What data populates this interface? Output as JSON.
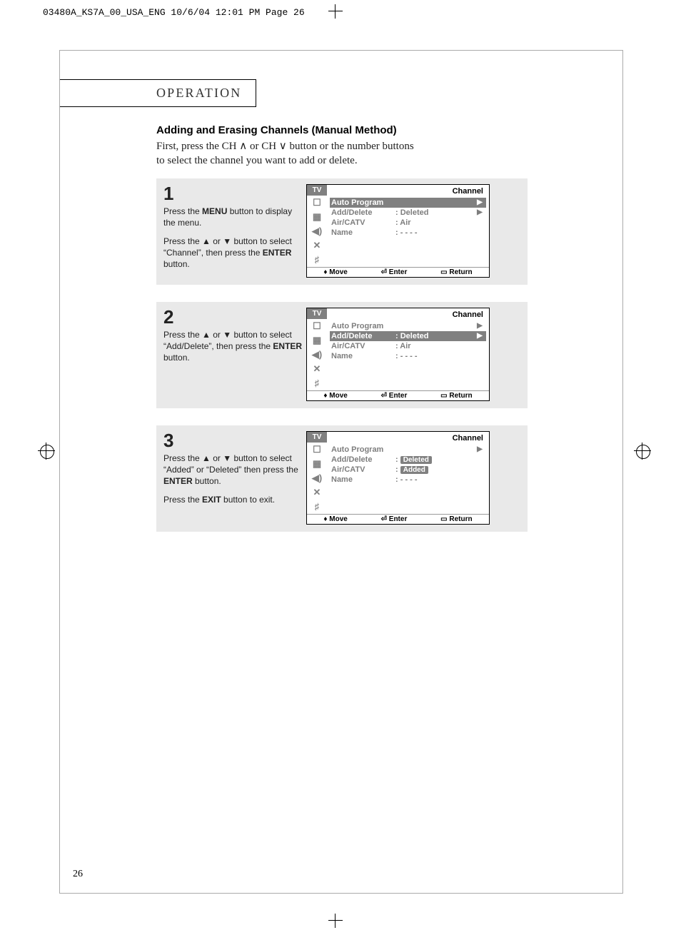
{
  "slug": "03480A_KS7A_00_USA_ENG  10/6/04  12:01 PM  Page 26",
  "section_title": "OPERATION",
  "heading": "Adding and Erasing Channels (Manual Method)",
  "intro_line1": "First, press the CH ∧ or CH ∨ button or the number buttons",
  "intro_line2": "to select the channel you want to add or delete.",
  "page_number": "26",
  "steps": [
    {
      "num": "1",
      "text_parts": [
        "Press the <b>MENU</b> button to display the menu.",
        "Press the ▲ or ▼ button to select “Channel”, then press the <b>ENTER</b> button."
      ],
      "osd_title": "Channel",
      "osd_rows": [
        {
          "label": "Auto Program",
          "val": "",
          "arrow": "▶",
          "sel": true
        },
        {
          "label": "Add/Delete",
          "val": ":  Deleted",
          "arrow": "▶",
          "sel": false
        },
        {
          "label": "Air/CATV",
          "val": ":  Air",
          "arrow": "",
          "sel": false
        },
        {
          "label": "Name",
          "val": ":  - - - -",
          "arrow": "",
          "sel": false
        }
      ]
    },
    {
      "num": "2",
      "text_parts": [
        "Press the ▲ or ▼ button to select “Add/Delete”, then press the <b>ENTER</b> button."
      ],
      "osd_title": "Channel",
      "osd_rows": [
        {
          "label": "Auto Program",
          "val": "",
          "arrow": "▶",
          "sel": false
        },
        {
          "label": "Add/Delete",
          "val": ":  Deleted",
          "arrow": "▶",
          "sel": true
        },
        {
          "label": "Air/CATV",
          "val": ":  Air",
          "arrow": "",
          "sel": false
        },
        {
          "label": "Name",
          "val": ":  - - - -",
          "arrow": "",
          "sel": false
        }
      ]
    },
    {
      "num": "3",
      "text_parts": [
        "Press the ▲ or ▼ button to select “Added” or “Deleted” then press the <b>ENTER</b> button.",
        "Press the <b>EXIT</b> button to exit."
      ],
      "osd_title": "Channel",
      "osd_rows": [
        {
          "label": "Auto Program",
          "val": "",
          "arrow": "▶",
          "sel": false
        },
        {
          "label": "Add/Delete",
          "val": ": ",
          "pill": "Deleted",
          "arrow": "",
          "sel": false
        },
        {
          "label": "Air/CATV",
          "val": ": ",
          "pill": "Added",
          "arrow": "",
          "sel": false
        },
        {
          "label": "Name",
          "val": ":  - - - -",
          "arrow": "",
          "sel": false
        }
      ]
    }
  ],
  "osd_tv_label": "TV",
  "osd_foot": {
    "move": "Move",
    "enter": "Enter",
    "return": "Return"
  },
  "side_icons": [
    "▣",
    "▤",
    "◀)",
    "✕",
    "☰"
  ]
}
